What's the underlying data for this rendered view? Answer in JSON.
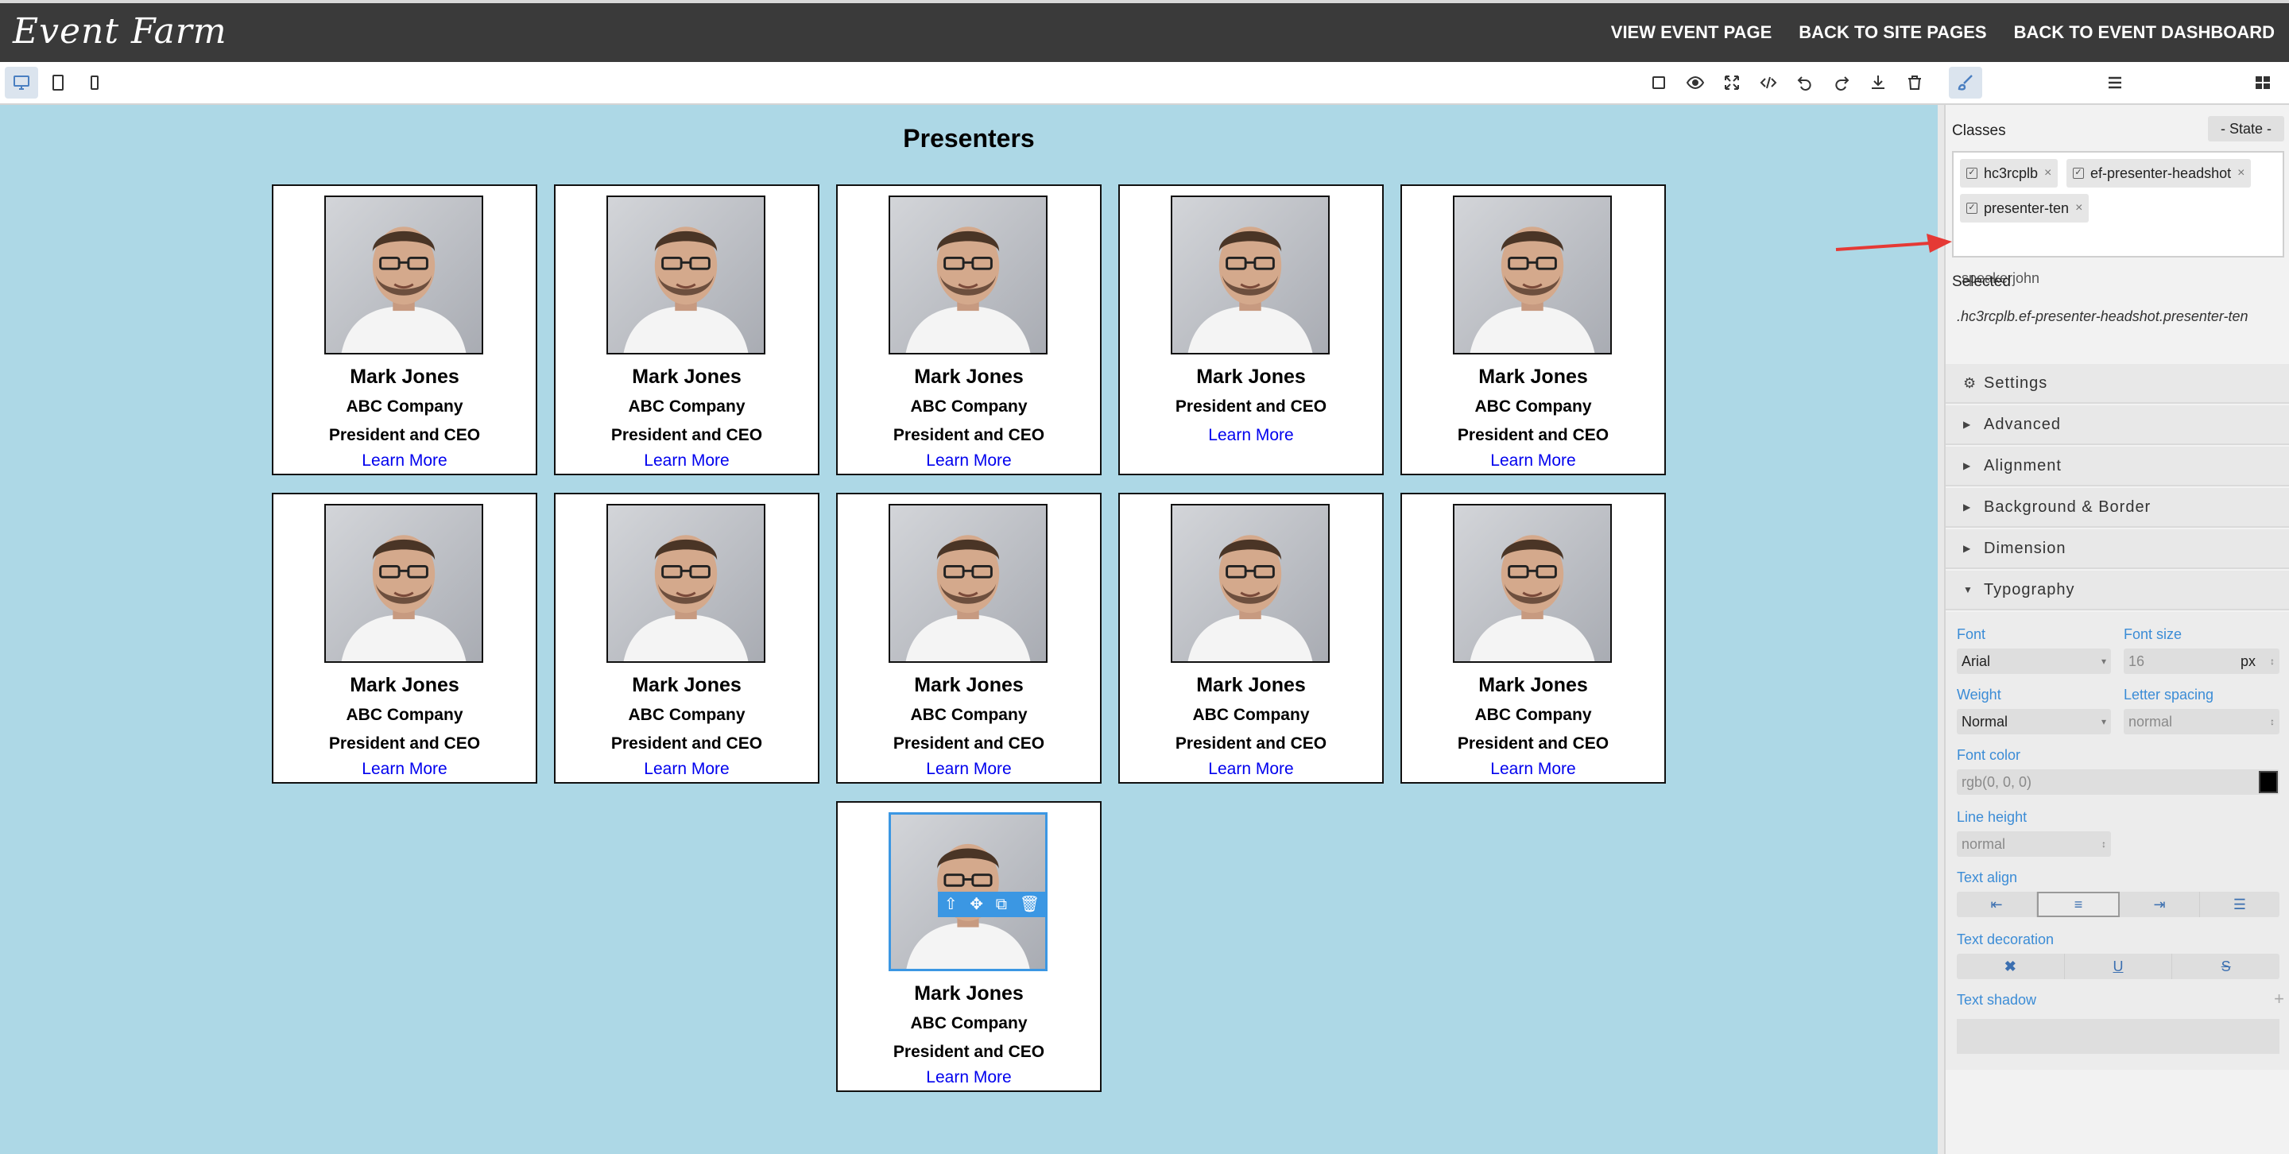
{
  "topbar": {
    "logo": "Event Farm",
    "nav": [
      "VIEW EVENT PAGE",
      "BACK TO SITE PAGES",
      "BACK TO EVENT DASHBOARD"
    ]
  },
  "toolbar": {
    "devices": [
      "desktop-icon",
      "tablet-icon",
      "mobile-icon"
    ],
    "actions": [
      "square-icon",
      "eye-icon",
      "fullscreen-icon",
      "code-icon",
      "undo-icon",
      "redo-icon",
      "download-icon",
      "trash-icon"
    ],
    "panels": [
      "paintbrush-icon",
      "layers-icon",
      "blocks-icon"
    ]
  },
  "canvas": {
    "title": "Presenters",
    "cards": [
      {
        "name": "Mark Jones",
        "company": "ABC Company",
        "role": "President and CEO",
        "link": "Learn More"
      },
      {
        "name": "Mark Jones",
        "company": "ABC Company",
        "role": "President and CEO",
        "link": "Learn More"
      },
      {
        "name": "Mark Jones",
        "company": "ABC Company",
        "role": "President and CEO",
        "link": "Learn More"
      },
      {
        "name": "Mark Jones",
        "company": "",
        "role": "President and CEO",
        "link": "Learn More"
      },
      {
        "name": "Mark Jones",
        "company": "ABC Company",
        "role": "President and CEO",
        "link": "Learn More"
      },
      {
        "name": "Mark Jones",
        "company": "ABC Company",
        "role": "President and CEO",
        "link": "Learn More"
      },
      {
        "name": "Mark Jones",
        "company": "ABC Company",
        "role": "President and CEO",
        "link": "Learn More"
      },
      {
        "name": "Mark Jones",
        "company": "ABC Company",
        "role": "President and CEO",
        "link": "Learn More"
      },
      {
        "name": "Mark Jones",
        "company": "ABC Company",
        "role": "President and CEO",
        "link": "Learn More"
      },
      {
        "name": "Mark Jones",
        "company": "ABC Company",
        "role": "President and CEO",
        "link": "Learn More"
      },
      {
        "name": "Mark Jones",
        "company": "ABC Company",
        "role": "President and CEO",
        "link": "Learn More"
      }
    ],
    "selection_toolbar": [
      "arrow-up-icon",
      "move-icon",
      "copy-icon",
      "trash-icon"
    ]
  },
  "panel": {
    "classes_label": "Classes",
    "state": "- State -",
    "tags": [
      "hc3rcplb",
      "ef-presenter-headshot",
      "presenter-ten"
    ],
    "class_input_value": "speakerjohn",
    "selected_label": "Selected",
    "selected_value": ".hc3rcplb.ef-presenter-headshot.presenter-ten",
    "sections": [
      "Settings",
      "Advanced",
      "Alignment",
      "Background & Border",
      "Dimension",
      "Typography"
    ],
    "typography": {
      "font_label": "Font",
      "font_value": "Arial",
      "size_label": "Font size",
      "size_value": "16",
      "size_unit": "px",
      "weight_label": "Weight",
      "weight_value": "Normal",
      "spacing_label": "Letter spacing",
      "spacing_value": "normal",
      "color_label": "Font color",
      "color_value": "rgb(0, 0, 0)",
      "lineheight_label": "Line height",
      "lineheight_value": "normal",
      "align_label": "Text align",
      "decoration_label": "Text decoration",
      "shadow_label": "Text shadow"
    }
  },
  "colors": {
    "topbar": "#3a3a3a",
    "canvas": "#add8e6",
    "link": "#0000ee",
    "selection": "#3b97e3",
    "panel_label": "#3b8cd6"
  }
}
